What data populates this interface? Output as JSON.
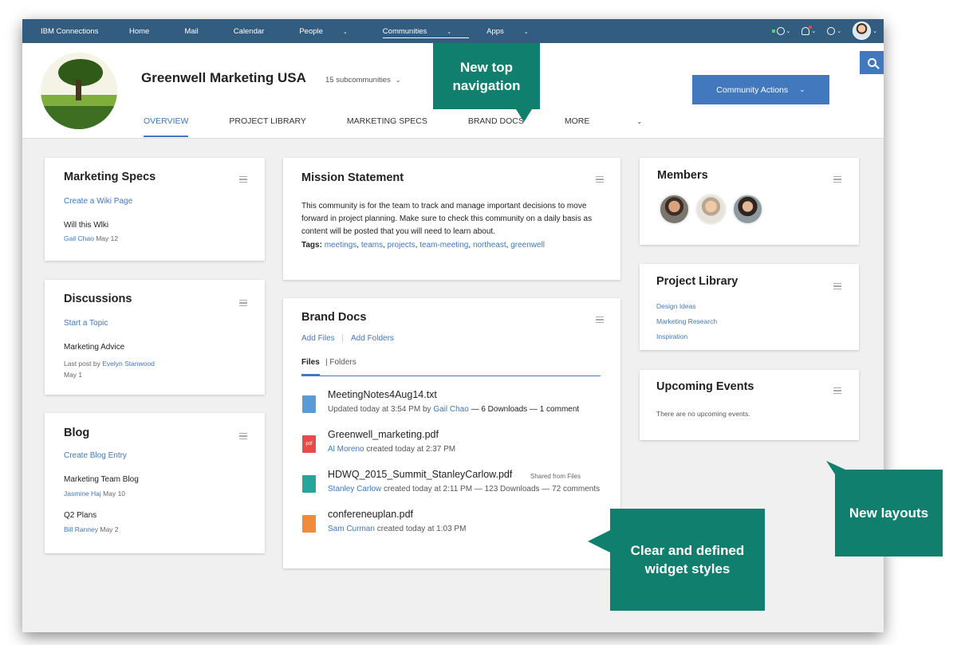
{
  "topbar": {
    "brand": "IBM Connections",
    "nav": [
      {
        "label": "Home",
        "chevron": false
      },
      {
        "label": "Mail",
        "chevron": false
      },
      {
        "label": "Calendar",
        "chevron": false
      },
      {
        "label": "People",
        "chevron": true
      },
      {
        "label": "Communities",
        "chevron": true,
        "active": true
      },
      {
        "label": "Apps",
        "chevron": true
      }
    ]
  },
  "header": {
    "title": "Greenwell Marketing USA",
    "subcommunities": "15 subcommunities",
    "actions_label": "Community Actions",
    "tabs": [
      "OVERVIEW",
      "PROJECT LIBRARY",
      "MARKETING SPECS",
      "BRAND DOCS",
      "MORE"
    ]
  },
  "marketing_specs": {
    "title": "Marketing Specs",
    "action": "Create a Wiki Page",
    "entry_title": "Will this Wlki",
    "entry_author": "Gail Chao",
    "entry_date": "May 12"
  },
  "discussions": {
    "title": "Discussions",
    "action": "Start a Topic",
    "topic": "Marketing Advice",
    "last_post_prefix": "Last post by",
    "last_post_author": "Evelyn Stanwood",
    "last_post_date": "May 1"
  },
  "blog": {
    "title": "Blog",
    "action": "Create Blog Entry",
    "entries": [
      {
        "title": "Marketing Team Blog",
        "author": "Jasmine Haj",
        "date": "May 10"
      },
      {
        "title": "Q2 Plans",
        "author": "Bill Ranney",
        "date": "May 2"
      }
    ]
  },
  "mission": {
    "title": "Mission Statement",
    "text_1": "This community is for the team to track and manage important decisions to move",
    "text_2": "forward in project planning. Make sure to check this community on a daily basis as",
    "text_3": "content will be posted that you will need to learn about.",
    "tags_label": "Tags:",
    "tags": [
      "meetings",
      "teams",
      "projects",
      "team-meeting",
      "northeast",
      "greenwell"
    ]
  },
  "brand_docs": {
    "title": "Brand Docs",
    "add_files": "Add Files",
    "add_folders": "Add Folders",
    "tab_files": "Files",
    "tab_folders": "Folders",
    "files": [
      {
        "name": "MeetingNotes4Aug14.txt",
        "pre": "Updated today at 3:54 PM by",
        "person": "Gail Chao",
        "post": "— 6 Downloads — 1 comment",
        "icon": "doc-icon"
      },
      {
        "name": "Greenwell_marketing.pdf",
        "pre": "",
        "person": "Al Moreno",
        "post": "created today at 2:37 PM",
        "icon": "pdf-icon",
        "icon_text": "pdf"
      },
      {
        "name": "HDWQ_2015_Summit_StanleyCarlow.pdf",
        "shared": "Shared from Files",
        "pre": "",
        "person": "Stanley Carlow",
        "post": "created today at 2:11 PM — 123 Downloads — 72 comments",
        "icon": "spreadsheet-icon"
      },
      {
        "name": "confereneuplan.pdf",
        "pre": "",
        "person": "Sam Curman",
        "post": "created today at 1:03 PM",
        "icon": "presentation-icon"
      }
    ]
  },
  "members": {
    "title": "Members"
  },
  "project_library": {
    "title": "Project Library",
    "items": [
      "Design Ideas",
      "Marketing Research",
      "Inspiration"
    ]
  },
  "events": {
    "title": "Upcoming Events",
    "empty": "There are no upcoming events."
  },
  "callouts": {
    "top_nav_1": "New top",
    "top_nav_2": "navigation",
    "layouts": "New layouts",
    "widgets_1": "Clear and defined",
    "widgets_2": "widget styles"
  },
  "colors": {
    "topbar": "#325c80",
    "accent": "#4178be",
    "link": "#3f78c0",
    "callout": "#107f6e"
  }
}
